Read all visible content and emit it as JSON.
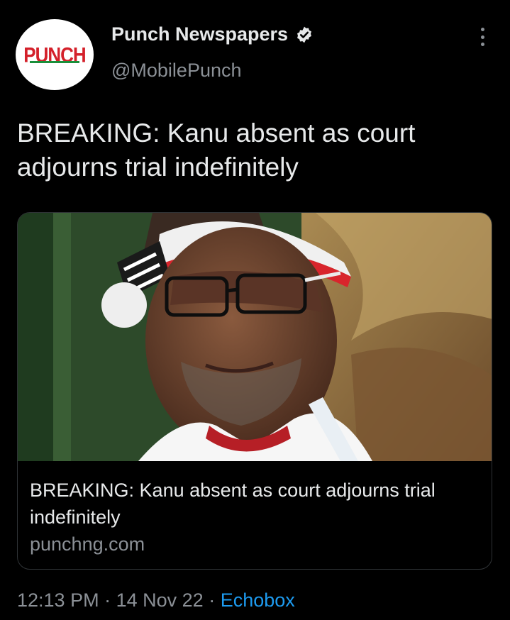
{
  "author": {
    "name": "Punch Newspapers",
    "handle": "@MobilePunch",
    "avatar_text": "PUNCH",
    "verified_icon": "verified-badge-icon"
  },
  "tweet": {
    "text": "BREAKING: Kanu absent as court adjourns trial indefinitely"
  },
  "card": {
    "title": "BREAKING: Kanu absent as court adjourns trial indefinitely",
    "domain": "punchng.com"
  },
  "meta": {
    "time": "12:13 PM",
    "sep1": "·",
    "date": "14 Nov 22",
    "sep2": "·",
    "source": "Echobox"
  },
  "colors": {
    "background": "#000000",
    "text": "#e7e9ea",
    "secondary": "#8b9096",
    "link": "#1d9bf0",
    "border": "#2f3336",
    "punch_red": "#d4202a"
  }
}
